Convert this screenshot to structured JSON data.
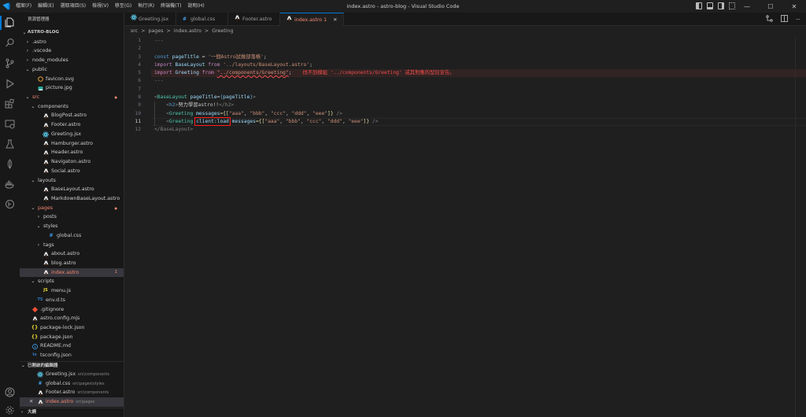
{
  "window": {
    "title": "index.astro - astro-blog - Visual Studio Code",
    "menu": [
      "檔案(F)",
      "編輯(E)",
      "選取項目(S)",
      "檢視(V)",
      "移至(G)",
      "執行(R)",
      "終端機(T)",
      "說明(H)"
    ],
    "controls": {
      "minimize": "—",
      "maximize": "☐",
      "close": "✕"
    }
  },
  "sidebar": {
    "title": "資源管理器",
    "root": "ASTRO-BLOG",
    "tree": [
      {
        "label": ".astro",
        "depth": 1,
        "kind": "folder-closed"
      },
      {
        "label": ".vscode",
        "depth": 1,
        "kind": "folder-closed"
      },
      {
        "label": "node_modules",
        "depth": 1,
        "kind": "folder-closed"
      },
      {
        "label": "public",
        "depth": 1,
        "kind": "folder-open"
      },
      {
        "label": "favicon.svg",
        "depth": 2,
        "kind": "svg"
      },
      {
        "label": "picture.jpg",
        "depth": 2,
        "kind": "img"
      },
      {
        "label": "src",
        "depth": 1,
        "kind": "folder-open",
        "color": "#f48771",
        "badge": "●"
      },
      {
        "label": "components",
        "depth": 2,
        "kind": "folder-open"
      },
      {
        "label": "BlogPost.astro",
        "depth": 3,
        "kind": "astro"
      },
      {
        "label": "Footer.astro",
        "depth": 3,
        "kind": "astro"
      },
      {
        "label": "Greeting.jsx",
        "depth": 3,
        "kind": "react"
      },
      {
        "label": "Hamburger.astro",
        "depth": 3,
        "kind": "astro"
      },
      {
        "label": "Header.astro",
        "depth": 3,
        "kind": "astro"
      },
      {
        "label": "Navigaton.astro",
        "depth": 3,
        "kind": "astro"
      },
      {
        "label": "Social.astro",
        "depth": 3,
        "kind": "astro"
      },
      {
        "label": "layouts",
        "depth": 2,
        "kind": "folder-open"
      },
      {
        "label": "BaseLayout.astro",
        "depth": 3,
        "kind": "astro"
      },
      {
        "label": "MarkdownBaseLayout.astro",
        "depth": 3,
        "kind": "astro"
      },
      {
        "label": "pages",
        "depth": 2,
        "kind": "folder-open",
        "color": "#f48771",
        "badge": "●"
      },
      {
        "label": "posts",
        "depth": 3,
        "kind": "folder-closed"
      },
      {
        "label": "styles",
        "depth": 3,
        "kind": "folder-open"
      },
      {
        "label": "global.css",
        "depth": 4,
        "kind": "css"
      },
      {
        "label": "tags",
        "depth": 3,
        "kind": "folder-closed"
      },
      {
        "label": "about.astro",
        "depth": 3,
        "kind": "astro"
      },
      {
        "label": "blog.astro",
        "depth": 3,
        "kind": "astro"
      },
      {
        "label": "index.astro",
        "depth": 3,
        "kind": "astro",
        "color": "#f48771",
        "badge": "1",
        "selected": true
      },
      {
        "label": "scripts",
        "depth": 2,
        "kind": "folder-open"
      },
      {
        "label": "menu.js",
        "depth": 3,
        "kind": "js"
      },
      {
        "label": "env.d.ts",
        "depth": 2,
        "kind": "ts"
      },
      {
        "label": ".gitignore",
        "depth": 1,
        "kind": "git"
      },
      {
        "label": "astro.config.mjs",
        "depth": 1,
        "kind": "astro"
      },
      {
        "label": "package-lock.json",
        "depth": 1,
        "kind": "json"
      },
      {
        "label": "package.json",
        "depth": 1,
        "kind": "json"
      },
      {
        "label": "README.md",
        "depth": 1,
        "kind": "md"
      },
      {
        "label": "tsconfig.json",
        "depth": 1,
        "kind": "tsjson"
      }
    ],
    "open_editors_title": "已開啟的編輯器",
    "open_editors": [
      {
        "label": "Greeting.jsx",
        "desc": "src\\components",
        "kind": "react"
      },
      {
        "label": "global.css",
        "desc": "src\\pages\\styles",
        "kind": "css"
      },
      {
        "label": "Footer.astro",
        "desc": "src\\components",
        "kind": "astro"
      },
      {
        "label": "index.astro",
        "desc": "src\\pages",
        "kind": "astro",
        "color": "#f48771",
        "active": true
      }
    ],
    "outline_title": "大綱"
  },
  "tabs": [
    {
      "label": "Greeting.jsx",
      "kind": "react"
    },
    {
      "label": "global.css",
      "kind": "css"
    },
    {
      "label": "Footer.astro",
      "kind": "astro"
    },
    {
      "label": "index.astro 1",
      "kind": "astro",
      "active": true
    }
  ],
  "breadcrumbs": [
    "src",
    ">",
    "pages",
    ">",
    "index.astro",
    ">",
    "Greeting"
  ],
  "editor": {
    "line_numbers": [
      "1",
      "2",
      "3",
      "4",
      "5",
      "6",
      "7",
      "8",
      "9",
      "10",
      "11",
      "12"
    ],
    "current_line": "11",
    "tokens": {
      "fm": "---",
      "const": "const",
      "pageTitle": "pageTitle",
      "eq": " = ",
      "title_str": "'一個Astro試做部落格'",
      "semi": ";",
      "import": "import",
      "BaseLayout": "BaseLayout",
      "from": "from",
      "bl_path": "'../layouts/BaseLayout.astro'",
      "Greeting": "Greeting",
      "gr_path": "\"../components/Greeting\"",
      "error_msg": "找不到模組 '../components/Greeting' 或其對應的型別宣告。",
      "lt": "<",
      "gt": ">",
      "pageTitleAttr": "pageTitle",
      "brace_open": "{",
      "brace_close": "}",
      "h2": "h2",
      "h2_text": "努力學習astro!!",
      "h2_close": "</h2>",
      "messages": "messages",
      "arr_open": "={[",
      "arr_close": "]}",
      "comma": ", ",
      "aaa": "\"aaa\"",
      "bbb": "\"bbb\"",
      "ccc": "\"ccc\"",
      "ddd": "\"ddd\"",
      "eee": "\"eee\"",
      "self_close": " />",
      "client": "client:load",
      "closing_bl": "</BaseLayout>"
    }
  }
}
